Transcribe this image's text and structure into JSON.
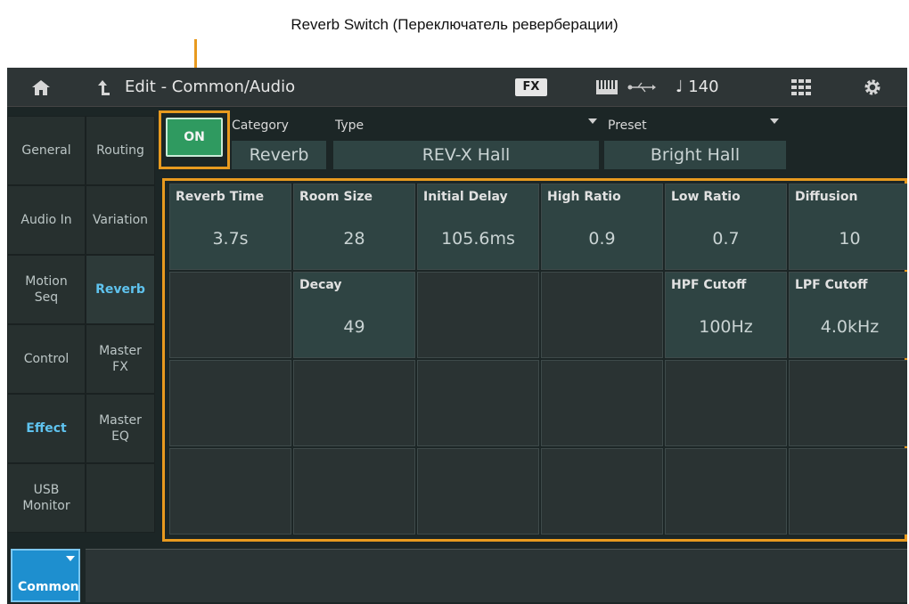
{
  "annotation": {
    "text": "Reverb Switch (Переключатель реверберации)"
  },
  "header": {
    "title": "Edit - Common/Audio",
    "fx_badge": "FX",
    "tempo": "♩ 140",
    "icons": [
      "home-icon",
      "back-arrow-icon",
      "keyboard-icon",
      "usb-icon",
      "grid-icon",
      "gear-icon"
    ]
  },
  "left_nav": [
    {
      "label": "General"
    },
    {
      "label": "Audio In"
    },
    {
      "label": "Motion\nSeq"
    },
    {
      "label": "Control"
    },
    {
      "label": "Effect"
    },
    {
      "label": "USB\nMonitor"
    }
  ],
  "right_nav": [
    {
      "label": "Routing"
    },
    {
      "label": "Variation"
    },
    {
      "label": "Reverb"
    },
    {
      "label": "Master\nFX"
    },
    {
      "label": "Master\nEQ"
    },
    {
      "label": ""
    }
  ],
  "reverb_switch": {
    "label": "ON"
  },
  "category": {
    "label": "Category",
    "value": "Reverb"
  },
  "type": {
    "label": "Type",
    "value": "REV-X Hall"
  },
  "preset": {
    "label": "Preset",
    "value": "Bright Hall"
  },
  "params": [
    {
      "label": "Reverb Time",
      "value": "3.7s"
    },
    {
      "label": "Room Size",
      "value": "28"
    },
    {
      "label": "Initial Delay",
      "value": "105.6ms"
    },
    {
      "label": "High Ratio",
      "value": "0.9"
    },
    {
      "label": "Low Ratio",
      "value": "0.7"
    },
    {
      "label": "Diffusion",
      "value": "10"
    },
    {
      "label": "Decay",
      "value": "49"
    },
    {
      "label": "HPF Cutoff",
      "value": "100Hz"
    },
    {
      "label": "LPF Cutoff",
      "value": "4.0kHz"
    }
  ],
  "bottom_tab": {
    "label": "Common"
  },
  "colors": {
    "accent_orange": "#e89a1f",
    "switch_green": "#2f9a60",
    "active_blue": "#5fc3ef",
    "tab_blue": "#1e8fcf"
  }
}
